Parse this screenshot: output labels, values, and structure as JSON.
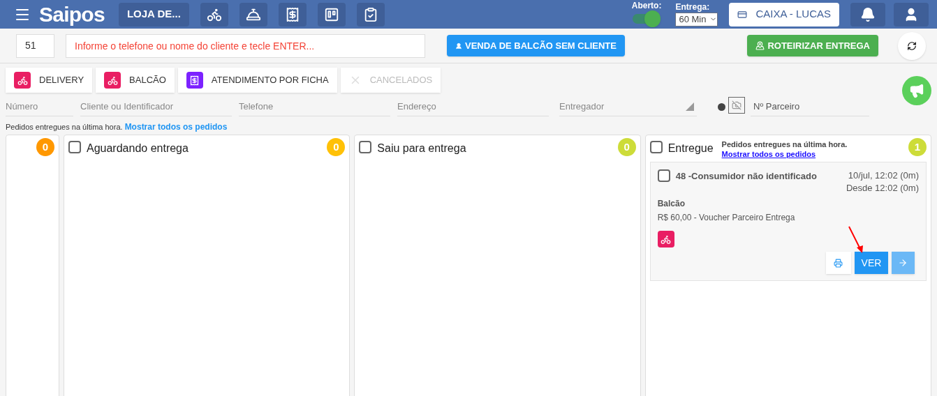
{
  "header": {
    "logo": "Saipos",
    "store": "LOJA DE...",
    "open_label": "Aberto:",
    "open": true,
    "delivery_label": "Entrega:",
    "delivery_time": "60 Min",
    "cashier": "CAIXA - LUCAS"
  },
  "toolbar": {
    "order_number": "51",
    "customer_placeholder": "Informe o telefone ou nome do cliente e tecle ENTER...",
    "counter_sale": "VENDA DE BALCÃO SEM CLIENTE",
    "route": "ROTEIRIZAR ENTREGA"
  },
  "tabs": [
    {
      "label": "DELIVERY",
      "kind": "delivery",
      "disabled": false
    },
    {
      "label": "BALCÃO",
      "kind": "counter",
      "disabled": false
    },
    {
      "label": "ATENDIMENTO POR FICHA",
      "kind": "ticket",
      "disabled": false
    },
    {
      "label": "CANCELADOS",
      "kind": "cancel",
      "disabled": true
    }
  ],
  "filters": [
    {
      "placeholder": "Número",
      "kind": "text"
    },
    {
      "placeholder": "Cliente ou Identificador",
      "kind": "text"
    },
    {
      "placeholder": "Telefone",
      "kind": "text"
    },
    {
      "placeholder": "Endereço",
      "kind": "text"
    },
    {
      "placeholder": "Entregador",
      "kind": "select"
    },
    {
      "placeholder": "Nº Parceiro",
      "kind": "partner"
    }
  ],
  "info": {
    "text": "Pedidos entregues na última hora.",
    "link": "Mostrar todos os pedidos"
  },
  "columns": [
    {
      "count": "0",
      "color": "#ff9800"
    },
    {
      "title": "Aguardando entrega",
      "count": "0",
      "color": "#ffc107",
      "checked": false
    },
    {
      "title": "Saiu para entrega",
      "count": "0",
      "color": "#cddc39",
      "checked": false
    },
    {
      "title": "Entregue",
      "count": "1",
      "color": "#cddc39",
      "checked": false,
      "note": "Pedidos entregues na última hora.",
      "link": "Mostrar todos os pedidos",
      "orders": [
        {
          "title": "48 -Consumidor não identificado",
          "date": "10/jul, 12:02 (0m)",
          "since": "Desde 12:02 (0m)",
          "type": "Balcão",
          "payment": "R$ 60,00 - Voucher Parceiro Entrega",
          "checked": false,
          "view": "VER"
        }
      ]
    }
  ]
}
